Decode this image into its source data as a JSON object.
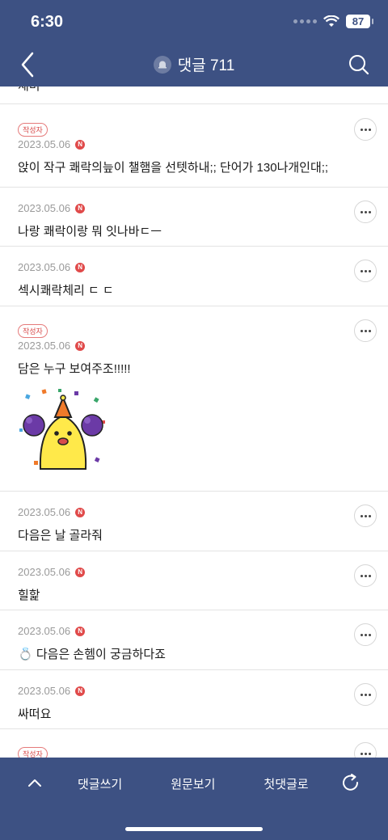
{
  "status_bar": {
    "time": "6:30",
    "battery": "87"
  },
  "header": {
    "title": "댓글 711"
  },
  "top_partial_text": "재미",
  "comments": [
    {
      "author_tag": "작성자",
      "date": "2023.05.06",
      "badge": "N",
      "text": "앉이 작구 쾌락의늪이 챌햄을 선텟하내;; 단어가 130나개인대;;"
    },
    {
      "author_tag": "",
      "date": "2023.05.06",
      "badge": "N",
      "text": "나랑 쾌락이랑 뭐 잇나바ㄷㅡ"
    },
    {
      "author_tag": "",
      "date": "2023.05.06",
      "badge": "N",
      "text": "섹시쾌락체리 ㄷ ㄷ"
    },
    {
      "author_tag": "작성자",
      "date": "2023.05.06",
      "badge": "N",
      "text": "담은 누구 보여주조!!!!!"
    },
    {
      "author_tag": "",
      "date": "2023.05.06",
      "badge": "N",
      "text": "다음은 날 골라줘"
    },
    {
      "author_tag": "",
      "date": "2023.05.06",
      "badge": "N",
      "text": "힐핥"
    },
    {
      "author_tag": "",
      "date": "2023.05.06",
      "badge": "N",
      "text": "💍 다음은 손헴이 궁금하다죠"
    },
    {
      "author_tag": "",
      "date": "2023.05.06",
      "badge": "N",
      "text": "싸떠요"
    },
    {
      "author_tag": "작성자",
      "date": "",
      "badge": "",
      "text": ""
    }
  ],
  "sticker": {
    "icon": "cheering-mascot-sticker",
    "colors": {
      "body": "#ffe94a",
      "pompom": "#6b3aa6",
      "hat": "#f07a2a"
    }
  },
  "footer": {
    "write": "댓글쓰기",
    "original": "원문보기",
    "first": "첫댓글로"
  },
  "theme": {
    "navy": "#3d5183",
    "badge_red": "#e04a4a"
  }
}
